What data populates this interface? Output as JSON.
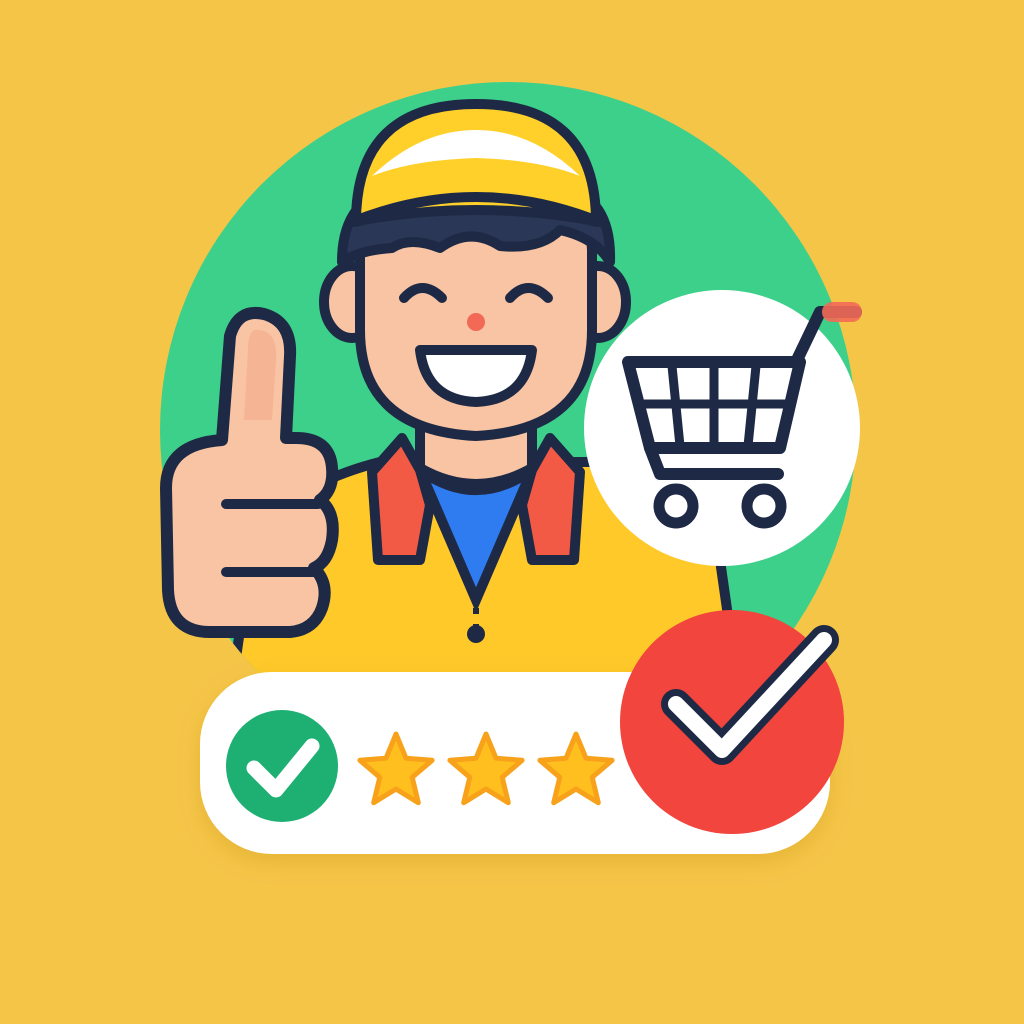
{
  "colors": {
    "background": "#F5C548",
    "badge_circle": "#3DD08A",
    "outline": "#1E2A45",
    "skin": "#F9C4A3",
    "skin_shade": "#F2A888",
    "cap_yellow": "#FFD02A",
    "cap_white": "#FFFFFF",
    "hair": "#2A3756",
    "shirt_yellow": "#FFC92A",
    "collar_red": "#F25A45",
    "undershirt_blue": "#2F7CF0",
    "nose": "#F26A55",
    "card_white": "#FFFFFF",
    "check_green": "#1DB072",
    "check_red": "#F2453D",
    "star_gold": "#FFBF1E",
    "star_orange": "#F7A21A"
  },
  "icons": {
    "person": "delivery-person-icon",
    "thumbs_up": "thumbs-up-icon",
    "cart": "shopping-cart-icon",
    "green_check": "check-circle-icon",
    "red_check": "check-circle-icon",
    "star": "star-icon"
  },
  "rating": {
    "stars_shown": 3
  }
}
